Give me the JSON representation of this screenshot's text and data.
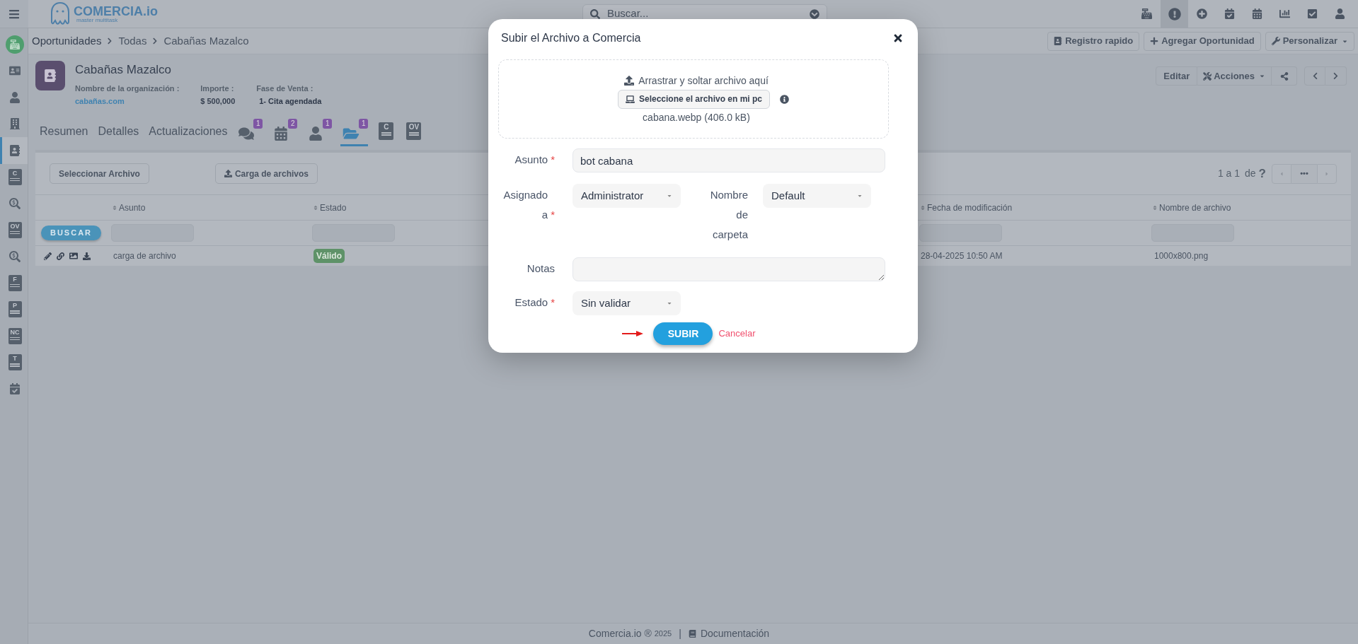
{
  "top_bar": {
    "logo": {
      "name": "COMERCIA.io",
      "tagline": "master multitask"
    },
    "search": {
      "placeholder": "Buscar..."
    },
    "tools": [
      {
        "kind": "register",
        "selected": false
      },
      {
        "kind": "alert",
        "selected": true
      },
      {
        "kind": "plus",
        "selected": false
      },
      {
        "kind": "calendar-check",
        "selected": false
      },
      {
        "kind": "calendar",
        "selected": false
      },
      {
        "kind": "chart",
        "selected": false
      },
      {
        "kind": "checkbox",
        "selected": false
      },
      {
        "kind": "user",
        "selected": false
      }
    ]
  },
  "sidebar": {
    "items": [
      {
        "kind": "home",
        "selected": false
      },
      {
        "kind": "card",
        "selected": false
      },
      {
        "kind": "user",
        "selected": false
      },
      {
        "kind": "building",
        "selected": false
      },
      {
        "kind": "contact",
        "selected": true
      },
      {
        "kind": "document",
        "glyph": "C",
        "selected": false
      },
      {
        "kind": "money-search",
        "selected": false
      },
      {
        "kind": "document",
        "glyph": "OV",
        "selected": false
      },
      {
        "kind": "money-search",
        "selected": false
      },
      {
        "kind": "document",
        "glyph": "F",
        "selected": false
      },
      {
        "kind": "document",
        "glyph": "P",
        "selected": false
      },
      {
        "kind": "document",
        "glyph": "NC",
        "selected": false
      },
      {
        "kind": "document",
        "glyph": "T",
        "selected": false
      },
      {
        "kind": "calendar-check",
        "selected": false
      }
    ]
  },
  "breadcrumb": [
    "Oportunidades",
    "Todas",
    "Cabañas Mazalco"
  ],
  "page_actions": [
    {
      "label": "Registro rapido",
      "kind": "contact"
    },
    {
      "label": "Agregar Oportunidad",
      "kind": "plus"
    },
    {
      "label": "Personalizar",
      "kind": "wrench"
    }
  ],
  "record": {
    "title": "Cabañas Mazalco",
    "fields": [
      {
        "label": "Nombre de la organización :",
        "value": "cabañas.com",
        "kind": "link"
      },
      {
        "label": "Importe :",
        "value": "$ 500,000",
        "kind": "plain"
      },
      {
        "label": "Fase de Venta :",
        "value": "1- Cita agendada",
        "kind": "strong"
      }
    ],
    "actions": [
      "Editar",
      "Acciones"
    ]
  },
  "tabs": [
    {
      "kind": "text",
      "label": "Resumen",
      "selected": false
    },
    {
      "kind": "text",
      "label": "Detalles",
      "selected": false
    },
    {
      "kind": "text",
      "label": "Actualizaciones",
      "selected": false
    },
    {
      "kind": "comments",
      "badge": "1",
      "selected": false
    },
    {
      "kind": "calendar",
      "badge": "2",
      "selected": false
    },
    {
      "kind": "contacts",
      "badge": "1",
      "selected": false
    },
    {
      "kind": "folder",
      "badge": "1",
      "selected": true
    },
    {
      "kind": "document",
      "glyph": "C",
      "selected": false
    },
    {
      "kind": "document",
      "glyph": "OV",
      "selected": false
    }
  ],
  "files": {
    "buttons": [
      {
        "label": "Seleccionar Archivo",
        "kind": "plain"
      },
      {
        "label": "Carga de archivos",
        "kind": "upload"
      }
    ],
    "pagination": {
      "range": "1 a 1",
      "of": "de",
      "total": "?",
      "page": "•••"
    },
    "search_button": "BUSCAR",
    "columns": [
      "Asunto",
      "Estado",
      "Fecha de modificación",
      "Nombre de archivo"
    ],
    "rows": [
      {
        "subject": "carga de archivo",
        "status": "Válido",
        "modified": "28-04-2025 10:50 AM",
        "filename": "1000x800.png"
      }
    ]
  },
  "footer": {
    "brand": "Comercia.io ®",
    "year": "2025",
    "separator": "|",
    "link": "Documentación"
  },
  "modal": {
    "title": "Subir el Archivo a Comercia",
    "dropzone": {
      "hint": "Arrastrar y soltar archivo aquí",
      "button": "Seleccione el archivo en mi pc",
      "file": "cabana.webp (406.0 kB)"
    },
    "fields": [
      {
        "label": "Asunto",
        "marker": "*",
        "kind": "text",
        "value": "bot cabana"
      },
      {
        "label": "Asignado a",
        "marker": "*",
        "kind": "select",
        "value": "Administrator"
      },
      {
        "label": "Nombre de carpeta",
        "kind": "select",
        "value": "Default"
      },
      {
        "label": "Notas",
        "kind": "textarea"
      },
      {
        "label": "Estado",
        "marker": "*",
        "kind": "select",
        "value": "Sin validar"
      }
    ],
    "submit": "SUBIR",
    "cancel": "Cancelar"
  }
}
